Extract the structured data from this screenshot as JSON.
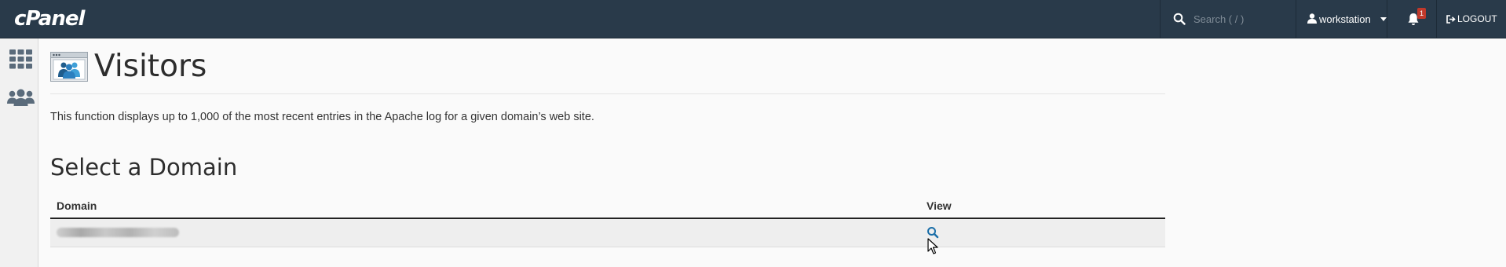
{
  "app": {
    "logo": "cPanel"
  },
  "header": {
    "search_placeholder": "Search ( / )",
    "username": "workstation",
    "notification_count": "1",
    "logout_label": "LOGOUT"
  },
  "sidebar": {
    "items": [
      {
        "icon": "grid-icon"
      },
      {
        "icon": "users-icon"
      }
    ]
  },
  "page": {
    "title": "Visitors",
    "description": "This function displays up to 1,000 of the most recent entries in the Apache log for a given domain’s web site.",
    "section_title": "Select a Domain"
  },
  "table": {
    "columns": [
      "Domain",
      "View"
    ],
    "rows": [
      {
        "domain": "",
        "view_icon": "search-icon"
      }
    ]
  },
  "colors": {
    "topbar": "#293a4a",
    "accent_link": "#1a6ea8",
    "badge": "#c0392b"
  }
}
